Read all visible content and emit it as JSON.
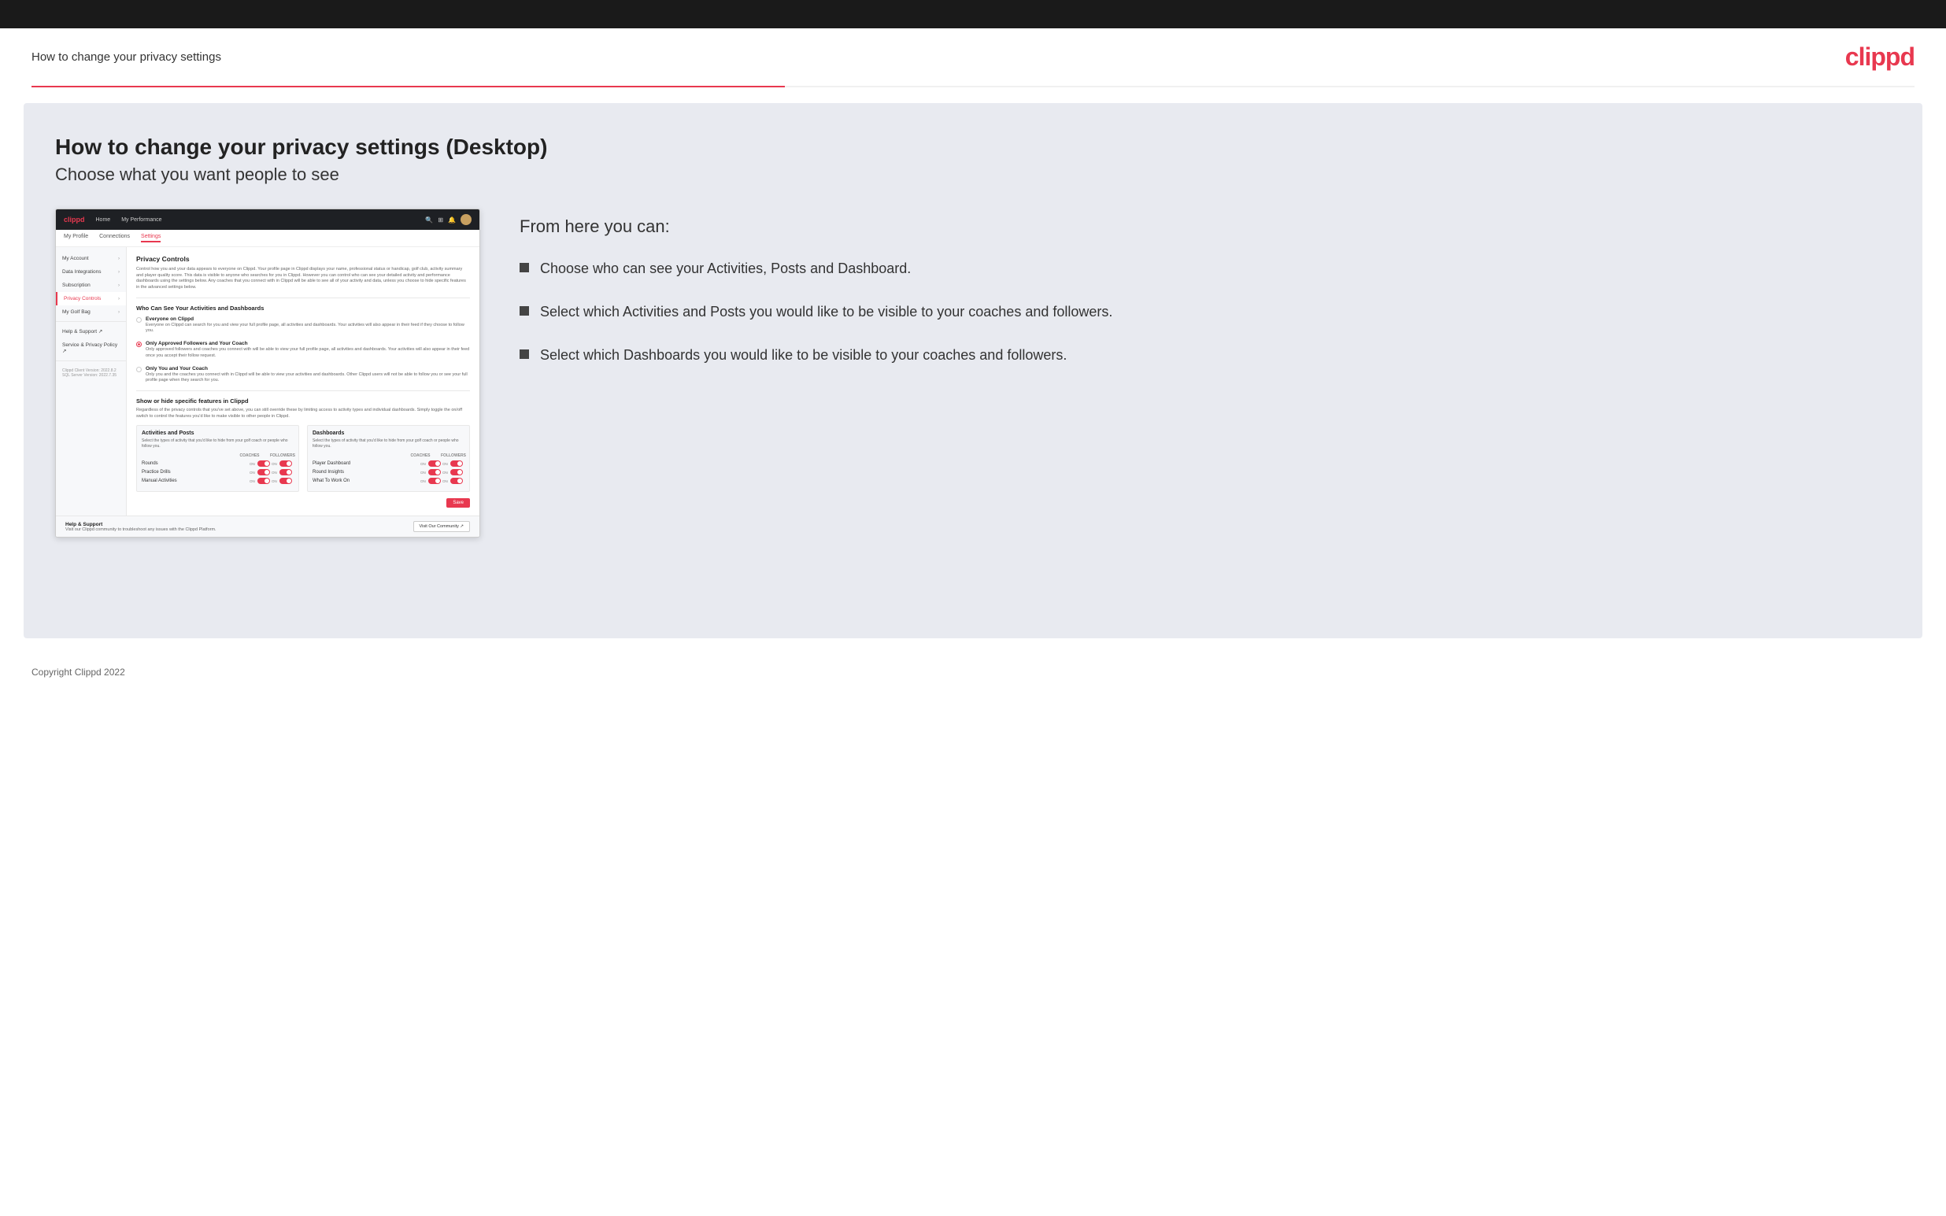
{
  "topBar": {},
  "header": {
    "title": "How to change your privacy settings",
    "logo": "clippd"
  },
  "mainContent": {
    "heading": "How to change your privacy settings (Desktop)",
    "subheading": "Choose what you want people to see",
    "fromHereTitle": "From here you can:",
    "bullets": [
      "Choose who can see your Activities, Posts and Dashboard.",
      "Select which Activities and Posts you would like to be visible to your coaches and followers.",
      "Select which Dashboards you would like to be visible to your coaches and followers."
    ]
  },
  "screenshot": {
    "nav": {
      "logo": "clippd",
      "links": [
        "Home",
        "My Performance"
      ]
    },
    "subnav": {
      "items": [
        "My Profile",
        "Connections",
        "Settings"
      ]
    },
    "sidebar": {
      "items": [
        {
          "label": "My Account",
          "active": false
        },
        {
          "label": "Data Integrations",
          "active": false
        },
        {
          "label": "Subscription",
          "active": false
        },
        {
          "label": "Privacy Controls",
          "active": true
        },
        {
          "label": "My Golf Bag",
          "active": false
        },
        {
          "label": "Help & Support ↗",
          "active": false
        },
        {
          "label": "Service & Privacy Policy ↗",
          "active": false
        }
      ],
      "version": "Clippd Client Version: 2022.8.2\nSQL Server Version: 2022.7.35"
    },
    "privacyControls": {
      "title": "Privacy Controls",
      "desc": "Control how you and your data appears to everyone on Clippd. Your profile page in Clippd displays your name, professional status or handicap, golf club, activity summary and player quality score. This data is visible to anyone who searches for you in Clippd. However you can control who can see your detailed activity and performance dashboards using the settings below. Any coaches that you connect with in Clippd will be able to see all of your activity and data, unless you choose to hide specific features in the advanced settings below.",
      "whoTitle": "Who Can See Your Activities and Dashboards",
      "radioOptions": [
        {
          "label": "Everyone on Clippd",
          "desc": "Everyone on Clippd can search for you and view your full profile page, all activities and dashboards. Your activities will also appear in their feed if they choose to follow you.",
          "selected": false
        },
        {
          "label": "Only Approved Followers and Your Coach",
          "desc": "Only approved followers and coaches you connect with will be able to view your full profile page, all activities and dashboards. Your activities will also appear in their feed once you accept their follow request.",
          "selected": true
        },
        {
          "label": "Only You and Your Coach",
          "desc": "Only you and the coaches you connect with in Clippd will be able to view your activities and dashboards. Other Clippd users will not be able to follow you or see your full profile page when they search for you.",
          "selected": false
        }
      ],
      "showHideTitle": "Show or hide specific features in Clippd",
      "showHideDesc": "Regardless of the privacy controls that you've set above, you can still override these by limiting access to activity types and individual dashboards. Simply toggle the on/off switch to control the features you'd like to make visible to other people in Clippd.",
      "activitiesAndPosts": {
        "title": "Activities and Posts",
        "desc": "Select the types of activity that you'd like to hide from your golf coach or people who follow you.",
        "columns": [
          "COACHES",
          "FOLLOWERS"
        ],
        "rows": [
          {
            "label": "Rounds",
            "coaches": "ON",
            "followers": "ON"
          },
          {
            "label": "Practice Drills",
            "coaches": "ON",
            "followers": "ON"
          },
          {
            "label": "Manual Activities",
            "coaches": "ON",
            "followers": "ON"
          }
        ]
      },
      "dashboards": {
        "title": "Dashboards",
        "desc": "Select the types of activity that you'd like to hide from your golf coach or people who follow you.",
        "columns": [
          "COACHES",
          "FOLLOWERS"
        ],
        "rows": [
          {
            "label": "Player Dashboard",
            "coaches": "ON",
            "followers": "ON"
          },
          {
            "label": "Round Insights",
            "coaches": "ON",
            "followers": "ON"
          },
          {
            "label": "What To Work On",
            "coaches": "ON",
            "followers": "ON"
          }
        ]
      },
      "saveLabel": "Save"
    },
    "helpSection": {
      "title": "Help & Support",
      "desc": "Visit our Clippd community to troubleshoot any issues with the Clippd Platform.",
      "btnLabel": "Visit Our Community ↗"
    }
  },
  "footer": {
    "copyright": "Copyright Clippd 2022"
  }
}
